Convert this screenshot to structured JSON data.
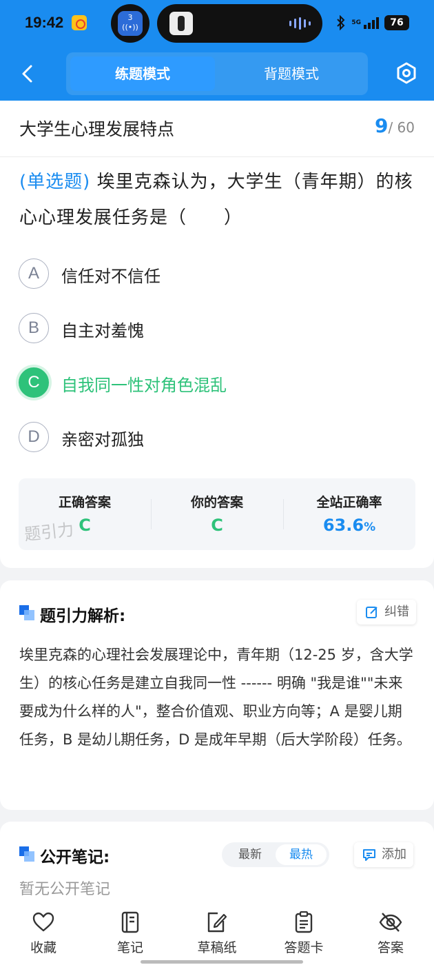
{
  "status_bar": {
    "time": "19:42",
    "small_pill_badge": "3",
    "network": "5G",
    "battery": "76"
  },
  "nav": {
    "mode_tabs": [
      "练题模式",
      "背题模式"
    ],
    "active_mode": "练题模式"
  },
  "chapter": {
    "title": "大学生心理发展特点",
    "current": "9",
    "total": "/ 60"
  },
  "question": {
    "type": "(单选题)",
    "stem": "埃里克森认为，大学生（青年期）的核心心理发展任务是（　　）",
    "options": [
      {
        "letter": "A",
        "text": "信任对不信任"
      },
      {
        "letter": "B",
        "text": "自主对羞愧"
      },
      {
        "letter": "C",
        "text": "自我同一性对角色混乱"
      },
      {
        "letter": "D",
        "text": "亲密对孤独"
      }
    ],
    "correct_option": "C"
  },
  "stats": {
    "correct_label": "正确答案",
    "correct_value": "C",
    "yours_label": "你的答案",
    "yours_value": "C",
    "rate_label": "全站正确率",
    "rate_value": "63.6",
    "rate_unit": "%",
    "watermark": "题引力"
  },
  "analysis": {
    "title": "题引力解析:",
    "report_label": "纠错",
    "text": "埃里克森的心理社会发展理论中，青年期（12-25 岁，含大学生）的核心任务是建立自我同一性 ------ 明确 \"我是谁\"\"未来要成为什么样的人\"，整合价值观、职业方向等；A 是婴儿期任务，B 是幼儿期任务，D 是成年早期（后大学阶段）任务。"
  },
  "notes": {
    "title": "公开笔记:",
    "sort_options": [
      "最新",
      "最热"
    ],
    "active_sort": "最热",
    "add_label": "添加",
    "empty_text": "暂无公开笔记"
  },
  "bottom_tabs": [
    {
      "label": "收藏",
      "icon": "heart-icon"
    },
    {
      "label": "笔记",
      "icon": "notebook-icon"
    },
    {
      "label": "草稿纸",
      "icon": "draft-icon"
    },
    {
      "label": "答题卡",
      "icon": "answer-card-icon"
    },
    {
      "label": "答案",
      "icon": "eye-off-icon"
    }
  ],
  "colors": {
    "brand": "#1a8cf0",
    "correct": "#2ec27a"
  }
}
